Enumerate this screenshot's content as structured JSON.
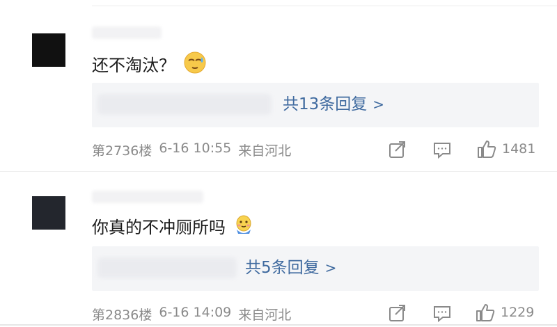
{
  "comments": [
    {
      "text": "还不淘汰？",
      "emoji_icon": "sweat-smile-icon",
      "reply_link": "共13条回复",
      "meta_floor": "第2736楼",
      "meta_time": "6-16 10:55",
      "meta_location": "来自河北",
      "like_count": "1481"
    },
    {
      "text": "你真的不冲厕所吗",
      "emoji_icon": "doge-blush-icon",
      "reply_link": "共5条回复",
      "meta_floor": "第2836楼",
      "meta_time": "6-16 14:09",
      "meta_location": "来自河北",
      "like_count": "1229"
    }
  ],
  "colors": {
    "link": "#3f6a9f",
    "meta": "#8a8a8a",
    "reply_bg": "#f4f5f7",
    "avatar1": "#111111",
    "avatar2": "#23262d"
  }
}
